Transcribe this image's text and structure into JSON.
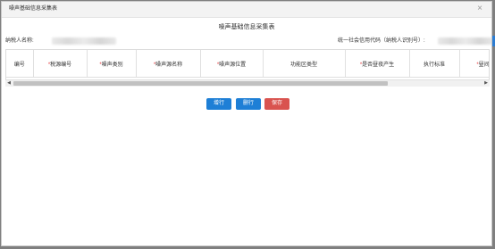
{
  "dialog": {
    "title": "噪声基础信息采集表",
    "close_symbol": "×"
  },
  "form": {
    "title": "噪声基础信息采集表",
    "taxpayer_name_label": "纳税人名称:",
    "credit_code_label": "统一社会信用代码（纳税人识别号）:"
  },
  "table": {
    "columns": [
      {
        "label": "编号",
        "required": false
      },
      {
        "label": "税源编号",
        "required": true
      },
      {
        "label": "噪声类别",
        "required": true
      },
      {
        "label": "噪声源名称",
        "required": true
      },
      {
        "label": "噪声源位置",
        "required": true
      },
      {
        "label": "功能区类型",
        "required": false
      },
      {
        "label": "是否昼夜产生",
        "required": true
      },
      {
        "label": "执行标准",
        "required": false
      },
      {
        "label": "昼间",
        "required": true
      }
    ],
    "required_mark": "*"
  },
  "scrollbar": {
    "left_arrow": "◀",
    "right_arrow": "▶",
    "position_fraction": 0.0,
    "visible_fraction": 0.8
  },
  "buttons": {
    "add_label": "增行",
    "delete_label": "删行",
    "save_label": "保存"
  },
  "colors": {
    "primary_button": "#1e7fd6",
    "danger_button": "#d9534f",
    "required_mark": "#e4393c"
  }
}
